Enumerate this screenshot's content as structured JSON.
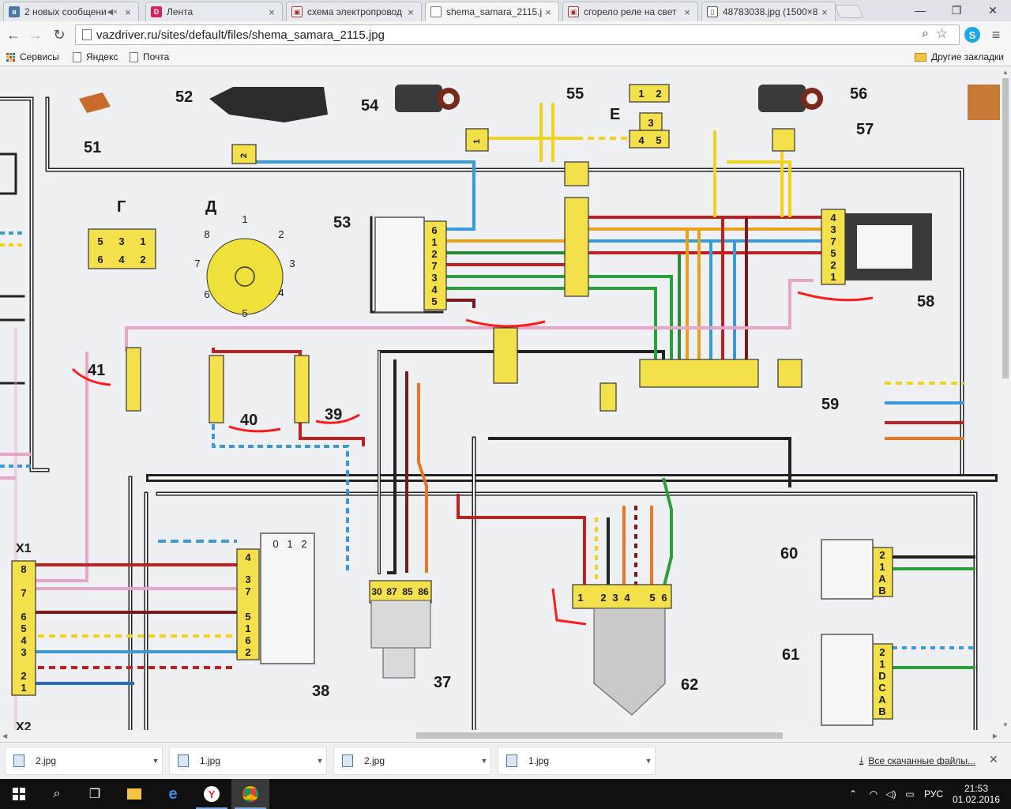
{
  "browser": {
    "tabs": [
      {
        "label": "2 новых сообщени",
        "icon": "vk-icon",
        "muted": true
      },
      {
        "label": "Лента",
        "icon": "drive2-icon"
      },
      {
        "label": "схема электропровод",
        "icon": "image-icon"
      },
      {
        "label": "shema_samara_2115.jp",
        "icon": "page-icon",
        "active": true
      },
      {
        "label": "сгорело реле на свет",
        "icon": "image-icon"
      },
      {
        "label": "48783038.jpg (1500×8",
        "icon": "image-icon"
      }
    ],
    "url": "vazdriver.ru/sites/default/files/shema_samara_2115.jpg",
    "bookmarks": [
      {
        "label": "Сервисы",
        "icon": "apps-icon"
      },
      {
        "label": "Яндекс",
        "icon": "page-icon"
      },
      {
        "label": "Почта",
        "icon": "page-icon"
      }
    ],
    "other_bookmarks": "Другие закладки"
  },
  "diagram": {
    "labels": {
      "c51": "51",
      "c52": "52",
      "c53": "53",
      "c54": "54",
      "c55": "55",
      "c56": "56",
      "c57": "57",
      "c58": "58",
      "c59": "59",
      "c60": "60",
      "c61": "61",
      "c62": "62",
      "c37": "37",
      "c38": "38",
      "c39": "39",
      "c40": "40",
      "c41": "41",
      "x1": "X1",
      "x2": "X2",
      "g": "Г",
      "d": "Д",
      "e": "Е"
    },
    "block_g": [
      "5",
      "3",
      "1",
      "6",
      "4",
      "2"
    ],
    "block_e_top": [
      "1",
      "2"
    ],
    "block_e_mid": "3",
    "block_e_bot": [
      "4",
      "5"
    ],
    "dial_numbers": [
      "1",
      "2",
      "3",
      "4",
      "5",
      "6",
      "7",
      "8"
    ],
    "conn53": [
      "6",
      "1",
      "2",
      "7",
      "3",
      "4",
      "5"
    ],
    "conn58": [
      "4",
      "3",
      "7",
      "5",
      "2",
      "1"
    ],
    "connX1": [
      "8",
      "7",
      "6",
      "5",
      "4",
      "3",
      "2",
      "1"
    ],
    "conn38_top": [
      "0",
      "1",
      "2"
    ],
    "conn38": [
      "4",
      "3",
      "7",
      "5",
      "1",
      "6",
      "2"
    ],
    "relay37": [
      "30",
      "87",
      "85",
      "86"
    ],
    "conn62": [
      "1",
      "2",
      "3",
      "4",
      "5",
      "6"
    ],
    "conn60": [
      "2",
      "1",
      "A",
      "B"
    ],
    "conn61": [
      "2",
      "1",
      "D",
      "C",
      "A",
      "B"
    ],
    "conn21": [
      "2",
      "1"
    ]
  },
  "downloads": {
    "items": [
      "2.jpg",
      "1.jpg",
      "2.jpg",
      "1.jpg"
    ],
    "all_label": "Все скачанные файлы..."
  },
  "taskbar": {
    "lang": "РУС",
    "time": "21:53",
    "date": "01.02.2016"
  }
}
